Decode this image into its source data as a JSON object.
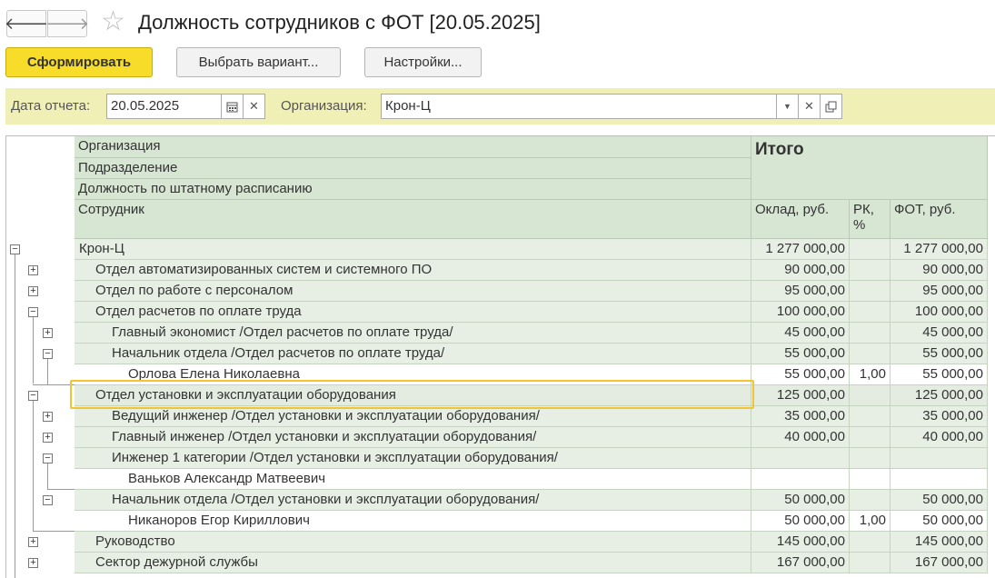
{
  "window": {
    "title": "Должность сотрудников с ФОТ [20.05.2025]",
    "back_glyph": "🡐",
    "forward_glyph": "🡒",
    "star_glyph": "☆"
  },
  "toolbar": {
    "generate_label": "Сформировать",
    "variant_label": "Выбрать вариант...",
    "settings_label": "Настройки..."
  },
  "filters": {
    "date_label": "Дата отчета:",
    "date_value": "20.05.2025",
    "org_label": "Организация:",
    "org_value": "Крон-Ц"
  },
  "header": {
    "levels": [
      "Организация",
      "Подразделение",
      "Должность по штатному расписанию",
      "Сотрудник"
    ],
    "total_label": "Итого",
    "col_salary": "Оклад, руб.",
    "col_rk": "РК, %",
    "col_fot": "ФОТ, руб."
  },
  "rows": [
    {
      "name": "Крон-Ц",
      "salary": "1 277 000,00",
      "rk": "",
      "fot": "1 277 000,00",
      "level": 0,
      "toggle": "⊟",
      "kind": "grp"
    },
    {
      "name": "Отдел автоматизированных систем и системного ПО",
      "salary": "90 000,00",
      "rk": "",
      "fot": "90 000,00",
      "level": 1,
      "toggle": "⊞",
      "kind": "grp"
    },
    {
      "name": "Отдел по работе с персоналом",
      "salary": "95 000,00",
      "rk": "",
      "fot": "95 000,00",
      "level": 1,
      "toggle": "⊞",
      "kind": "grp"
    },
    {
      "name": "Отдел расчетов по оплате труда",
      "salary": "100 000,00",
      "rk": "",
      "fot": "100 000,00",
      "level": 1,
      "toggle": "⊟",
      "kind": "grp"
    },
    {
      "name": "Главный экономист /Отдел расчетов по оплате труда/",
      "salary": "45 000,00",
      "rk": "",
      "fot": "45 000,00",
      "level": 2,
      "toggle": "⊞",
      "kind": "grp"
    },
    {
      "name": "Начальник отдела /Отдел расчетов по оплате труда/",
      "salary": "55 000,00",
      "rk": "",
      "fot": "55 000,00",
      "level": 2,
      "toggle": "⊟",
      "kind": "grp"
    },
    {
      "name": "Орлова Елена Николаевна",
      "salary": "55 000,00",
      "rk": "1,00",
      "fot": "55 000,00",
      "level": 3,
      "toggle": "",
      "kind": "emp"
    },
    {
      "name": "Отдел установки и эксплуатации оборудования",
      "salary": "125 000,00",
      "rk": "",
      "fot": "125 000,00",
      "level": 1,
      "toggle": "⊟",
      "kind": "sel"
    },
    {
      "name": "Ведущий инженер /Отдел установки и эксплуатации оборудования/",
      "salary": "35 000,00",
      "rk": "",
      "fot": "35 000,00",
      "level": 2,
      "toggle": "⊞",
      "kind": "grp"
    },
    {
      "name": "Главный инженер /Отдел установки и эксплуатации оборудования/",
      "salary": "40 000,00",
      "rk": "",
      "fot": "40 000,00",
      "level": 2,
      "toggle": "⊞",
      "kind": "grp"
    },
    {
      "name": "Инженер 1 категории /Отдел установки и эксплуатации оборудования/",
      "salary": "",
      "rk": "",
      "fot": "",
      "level": 2,
      "toggle": "⊟",
      "kind": "grp"
    },
    {
      "name": "Ваньков Александр Матвеевич",
      "salary": "",
      "rk": "",
      "fot": "",
      "level": 3,
      "toggle": "",
      "kind": "emp"
    },
    {
      "name": "Начальник отдела /Отдел установки и эксплуатации оборудования/",
      "salary": "50 000,00",
      "rk": "",
      "fot": "50 000,00",
      "level": 2,
      "toggle": "⊟",
      "kind": "grp"
    },
    {
      "name": "Никаноров Егор Кириллович",
      "salary": "50 000,00",
      "rk": "1,00",
      "fot": "50 000,00",
      "level": 3,
      "toggle": "",
      "kind": "emp"
    },
    {
      "name": "Руководство",
      "salary": "145 000,00",
      "rk": "",
      "fot": "145 000,00",
      "level": 1,
      "toggle": "⊞",
      "kind": "grp"
    },
    {
      "name": "Сектор дежурной службы",
      "salary": "167 000,00",
      "rk": "",
      "fot": "167 000,00",
      "level": 1,
      "toggle": "⊞",
      "kind": "grp"
    }
  ]
}
